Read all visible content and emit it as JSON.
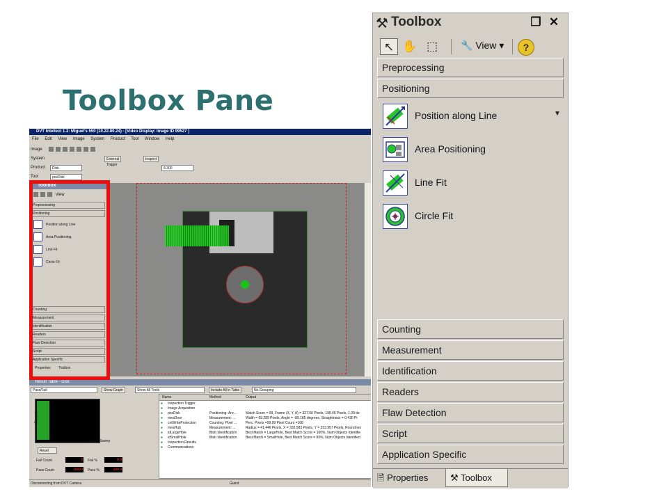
{
  "slide": {
    "title": "Toolbox Pane"
  },
  "toolbox": {
    "title": "Toolbox",
    "view_label": "View",
    "categories_top": [
      "Preprocessing",
      "Positioning"
    ],
    "tools": [
      {
        "label": "Position along Line",
        "icon": "position-along-line-icon"
      },
      {
        "label": "Area Positioning",
        "icon": "area-positioning-icon"
      },
      {
        "label": "Line Fit",
        "icon": "line-fit-icon"
      },
      {
        "label": "Circle Fit",
        "icon": "circle-fit-icon"
      }
    ],
    "categories_bottom": [
      "Counting",
      "Measurement",
      "Identification",
      "Readers",
      "Flaw Detection",
      "Script",
      "Application Specific"
    ],
    "tabs": [
      "Properties",
      "Toolbox"
    ]
  },
  "app": {
    "title": "DVT Intellect 1.3: Miguel's 550 (10.22.80.24) - [Video Display: Image ID 99527 ]",
    "menu": [
      "File",
      "Edit",
      "View",
      "Image",
      "System",
      "Product",
      "Tool",
      "Window",
      "Help"
    ],
    "row_image": "Image",
    "row_system": "System",
    "external_trigger": "External Trigger",
    "inspect": "Inspect",
    "row_product": "Product",
    "product_value": "Disk",
    "exposure_value": "8.300",
    "row_tool": "Tool",
    "tool_value": "posDisk",
    "mini_toolbox_title": "Toolbox",
    "mini_view": "View",
    "results_title": "Result Table - Disk",
    "pass_fail": "Pass/Fail",
    "show_graph": "Show Graph",
    "show_all_tools": "Show All Tools",
    "include_all": "Include All in Table",
    "no_grouping": "No Grouping",
    "graph_ylabel": "Percent",
    "graph_xlabel": "History Sweep",
    "reset": "Reset",
    "fail_count": "Fail Count",
    "fail_pct": "Fail %",
    "pass_count": "Pass Count",
    "pass_pct": "Pass %",
    "fail_count_val": "0",
    "fail_pct_val": "0.0",
    "pass_count_val": "10000",
    "pass_pct_val": "100.0",
    "table_headers": [
      "Name",
      "Method",
      "Output"
    ],
    "table_rows": [
      {
        "name": "Inspection Trigger",
        "method": "",
        "output": ""
      },
      {
        "name": "Image Acquisition",
        "method": "",
        "output": ""
      },
      {
        "name": "posDisk",
        "method": "Positioning: Are...",
        "output": "Match Score = 99, Frame (X, Y, A) = 327.50 Pixels, 198.46 Pixels, 1.00 de"
      },
      {
        "name": "meaDoor",
        "method": "Measurement: ...",
        "output": "Width = 69.289 Pixels, Angle = -89.185 degrees, Straightness = 0.430 Pi"
      },
      {
        "name": "cntWriteProtection",
        "method": "Counting: Pixel ...",
        "output": "Perc. Pixels =99.99   Pixel Count =168"
      },
      {
        "name": "meaHub",
        "method": "Measurement: ...",
        "output": "Radius = 41.446 Pixels, X = 332.583 Pixels, Y = 233.957 Pixels, Roundnes"
      },
      {
        "name": "idLargeHole",
        "method": "Blob Identification",
        "output": "Best Match = LargeHole, Best Match Score = 100%, Num Objects Identifie"
      },
      {
        "name": "idSmallHole",
        "method": "Blob Identification",
        "output": "Best Match = SmallHole, Best Match Score = 99%, Num Objects Identified"
      },
      {
        "name": "Inspection Results",
        "method": "",
        "output": ""
      },
      {
        "name": "Communications",
        "method": "",
        "output": ""
      }
    ],
    "status_left": "Disconnecting from DVT Camera",
    "status_right": "Guest"
  }
}
